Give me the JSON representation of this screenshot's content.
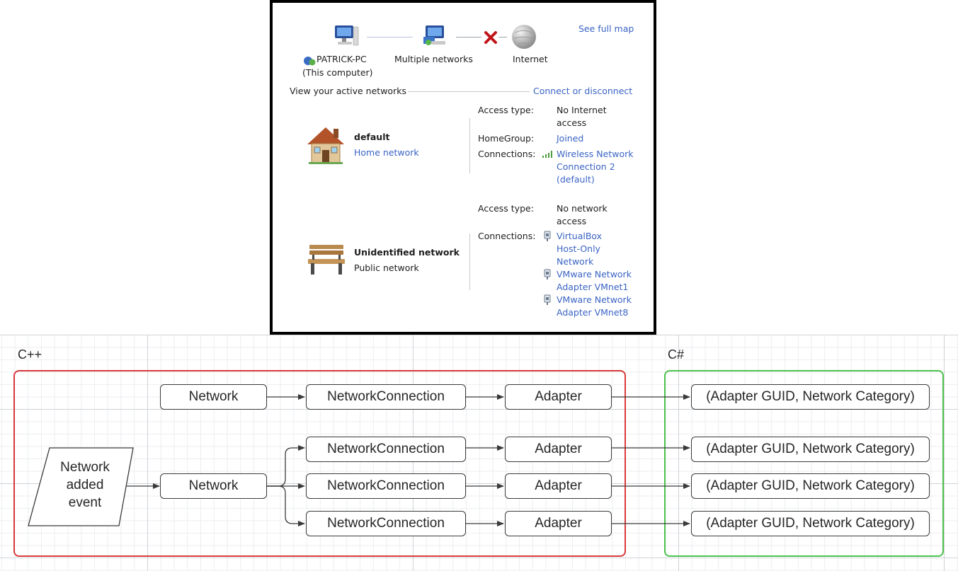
{
  "network_window": {
    "map": {
      "computer_name": "PATRICK-PC",
      "computer_sub": "(This computer)",
      "middle_label": "Multiple networks",
      "internet_label": "Internet",
      "see_full_map": "See full map"
    },
    "active_header": "View your active networks",
    "connect_link": "Connect or disconnect",
    "networks": [
      {
        "name": "default",
        "category": "Home network",
        "access_label": "Access type:",
        "access_line1": "No Internet",
        "access_line2": "access",
        "homegroup_label": "HomeGroup:",
        "homegroup_value": "Joined",
        "connections_label": "Connections:",
        "connection_lines": [
          "Wireless Network",
          "Connection 2",
          "(default)"
        ]
      },
      {
        "name": "Unidentified network",
        "category": "Public network",
        "access_label": "Access type:",
        "access_line1": "No network",
        "access_line2": "access",
        "connections_label": "Connections:",
        "connection_lines": [
          "VirtualBox",
          "Host-Only",
          "Network",
          "VMware Network",
          "Adapter VMnet1",
          "VMware Network",
          "Adapter VMnet8"
        ]
      }
    ]
  },
  "diagram": {
    "cpp_label": "C++",
    "csharp_label": "C#",
    "event_lines": [
      "Network",
      "added",
      "event"
    ],
    "row1": {
      "network": "Network",
      "connection": "NetworkConnection",
      "adapter": "Adapter",
      "tuple": "(Adapter GUID, Network Category)"
    },
    "row2_network": "Network",
    "connections": [
      "NetworkConnection",
      "NetworkConnection",
      "NetworkConnection"
    ],
    "adapters": [
      "Adapter",
      "Adapter",
      "Adapter"
    ],
    "tuples": [
      "(Adapter GUID, Network Category)",
      "(Adapter GUID, Network Category)",
      "(Adapter GUID, Network Category)"
    ],
    "colors": {
      "cpp_border": "#d93a3a",
      "csharp_border": "#4cc24c"
    }
  }
}
